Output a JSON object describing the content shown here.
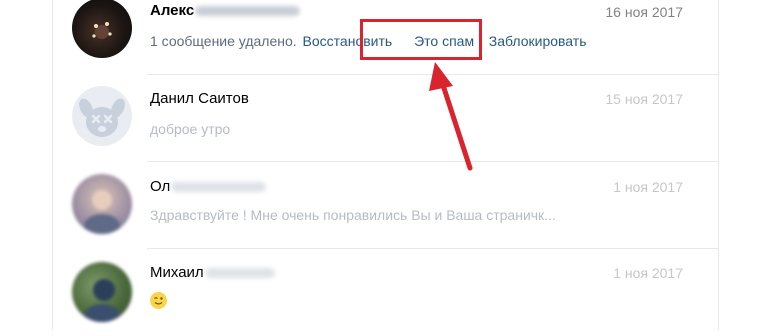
{
  "dialogs": [
    {
      "name": "Алекс",
      "date": "16 ноя 2017",
      "deleted_notice": "1 сообщение удалено.",
      "restore_label": "Восстановить",
      "spam_label": "Это спам",
      "block_label": "Заблокировать",
      "separator": "·"
    },
    {
      "name": "Данил Саитов",
      "date": "15 ноя 2017",
      "message": "доброе утро"
    },
    {
      "name": "Ол",
      "date": "1 ноя 2017",
      "message": "Здравствуйте ! Мне очень понравились Вы и Ваша страничк..."
    },
    {
      "name": "Михаил",
      "date": "1 ноя 2017",
      "message_icon": "winking-smiley-emoji"
    }
  ],
  "colors": {
    "accent_link": "#2a5885",
    "highlight": "#d9232d"
  }
}
